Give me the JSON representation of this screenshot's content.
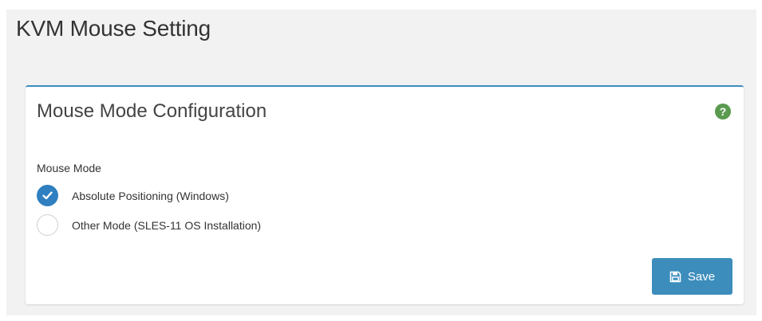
{
  "page": {
    "title": "KVM Mouse Setting"
  },
  "panel": {
    "title": "Mouse Mode Configuration",
    "help_icon": "question-circle-icon",
    "help_glyph": "?",
    "field_label": "Mouse Mode",
    "options": [
      {
        "label": "Absolute Positioning (Windows)",
        "checked": true
      },
      {
        "label": "Other Mode (SLES-11 OS Installation)",
        "checked": false
      }
    ],
    "save_label": "Save",
    "save_icon": "floppy-disk-icon"
  },
  "colors": {
    "accent": "#3c8dbc",
    "radio_checked": "#2f7fc1",
    "help_icon": "#5a9a4f"
  }
}
